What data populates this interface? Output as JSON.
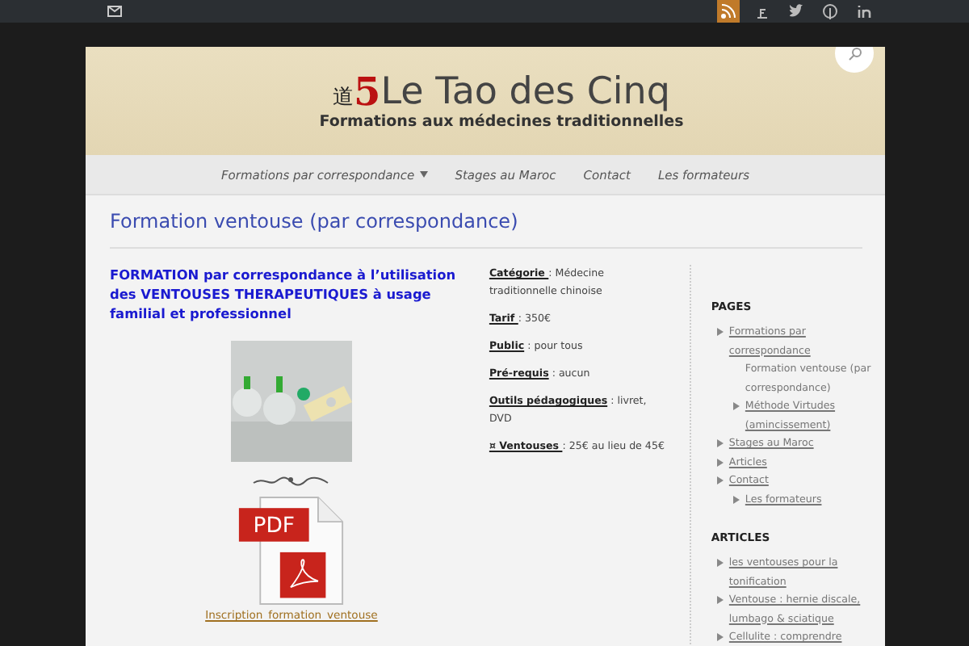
{
  "site": {
    "logo_glyph": "道",
    "logo_digit": "5",
    "title": "Le Tao des Cinq",
    "tagline": "Formations aux médecines traditionnelles"
  },
  "nav": [
    {
      "label": "Formations par correspondance",
      "has_submenu": true
    },
    {
      "label": "Stages au Maroc",
      "has_submenu": false
    },
    {
      "label": "Contact",
      "has_submenu": false
    },
    {
      "label": "Les formateurs",
      "has_submenu": false
    }
  ],
  "page_title": "Formation ventouse (par correspondance)",
  "intro": "FORMATION par correspondance à l’utilisation des VENTOUSES THERAPEUTIQUES à usage familial et professionnel",
  "pdf_badge": "PDF",
  "download_link": "Inscription_formation_ventouse",
  "details": [
    {
      "label": "Catégorie ",
      "value": ": Médecine traditionnelle chinoise"
    },
    {
      "label": "Tarif ",
      "value": ":  350€"
    },
    {
      "label": "Public",
      "value": " : pour tous"
    },
    {
      "label": "Pré-requis",
      "value": " : aucun"
    },
    {
      "label": "Outils pédagogiques",
      "value": " : livret, DVD"
    },
    {
      "label": "¤ Ventouses ",
      "value": ": 25€ au lieu de 45€"
    }
  ],
  "sidebar": [
    {
      "heading": "PAGES",
      "items": [
        {
          "label": "Formations par correspondance",
          "selected": false,
          "children": [
            {
              "label": "Formation ventouse (par correspondance)",
              "selected": true
            },
            {
              "label": "Méthode Virtudes (amincissement)",
              "selected": false
            }
          ]
        },
        {
          "label": "Stages au Maroc",
          "selected": false
        },
        {
          "label": "Articles",
          "selected": false
        },
        {
          "label": "Contact",
          "selected": false,
          "children": [
            {
              "label": "Les formateurs",
              "selected": false
            }
          ]
        }
      ]
    },
    {
      "heading": "ARTICLES",
      "items": [
        {
          "label": "les ventouses pour la tonification",
          "selected": false
        },
        {
          "label": "Ventouse : hernie discale, lumbago & sciatique",
          "selected": false
        },
        {
          "label": "Cellulite : comprendre",
          "selected": false
        }
      ]
    }
  ]
}
